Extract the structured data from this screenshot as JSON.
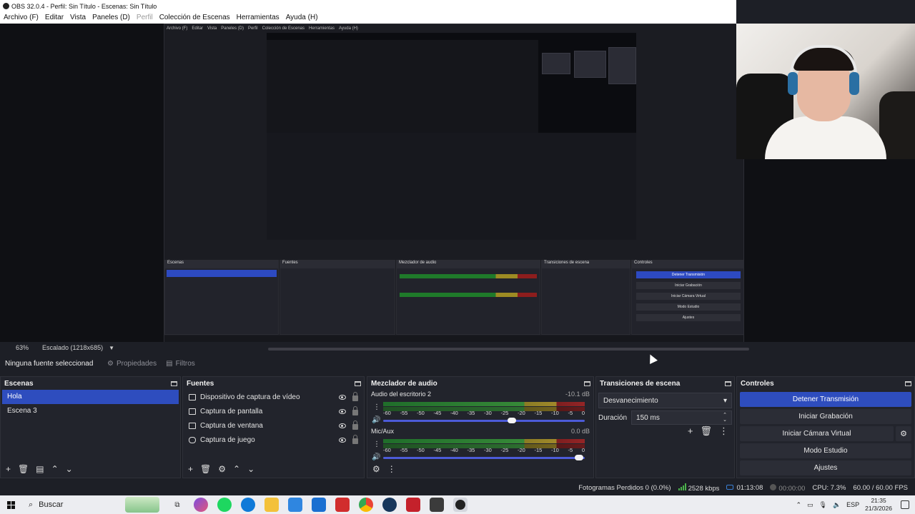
{
  "window": {
    "title": "OBS 32.0.4 - Perfil: Sin Título - Escenas: Sin Título"
  },
  "menu": {
    "items": [
      "Archivo (F)",
      "Editar",
      "Vista",
      "Paneles (D)",
      "Perfil",
      "Colección de Escenas",
      "Herramientas",
      "Ayuda (H)"
    ]
  },
  "preview": {
    "zoom": "63%",
    "scale_label": "Escalado (1218x685)",
    "nested": {
      "menu": [
        "Archivo (F)",
        "Editar",
        "Vista",
        "Paneles (D)",
        "Perfil",
        "Colección de Escenas",
        "Herramientas",
        "Ayuda (H)"
      ],
      "docks": [
        "Escenas",
        "Fuentes",
        "Mezclador de audio",
        "Transiciones de escena",
        "Controles"
      ],
      "buttons": [
        "Detener Transmisión",
        "Iniciar Grabación",
        "Iniciar Cámara Virtual",
        "Modo Estudio",
        "Ajustes"
      ]
    }
  },
  "context_bar": {
    "no_source": "Ninguna fuente seleccionad",
    "properties": "Propiedades",
    "filters": "Filtros"
  },
  "scenes": {
    "title": "Escenas",
    "items": [
      {
        "label": "Hola",
        "selected": true
      },
      {
        "label": "Escena 3",
        "selected": false
      }
    ]
  },
  "sources": {
    "title": "Fuentes",
    "items": [
      {
        "label": "Dispositivo de captura de vídeo",
        "icon": "camera-icon"
      },
      {
        "label": "Captura de pantalla",
        "icon": "monitor-icon"
      },
      {
        "label": "Captura de ventana",
        "icon": "window-icon"
      },
      {
        "label": "Captura de juego",
        "icon": "gamepad-icon"
      }
    ]
  },
  "mixer": {
    "title": "Mezclador de audio",
    "channels": [
      {
        "name": "Audio del escritorio 2",
        "db": "-10.1 dB",
        "fader": 0.64
      },
      {
        "name": "Mic/Aux",
        "db": "0.0 dB",
        "fader": 0.97
      }
    ],
    "ticks": [
      "-60",
      "-55",
      "-50",
      "-45",
      "-40",
      "-35",
      "-30",
      "-25",
      "-20",
      "-15",
      "-10",
      "-5",
      "0"
    ]
  },
  "transitions": {
    "title": "Transiciones de escena",
    "selected": "Desvanecimiento",
    "duration_label": "Duración",
    "duration_value": "150 ms"
  },
  "controls": {
    "title": "Controles",
    "stop_stream": "Detener Transmisión",
    "start_recording": "Iniciar Grabación",
    "start_virtualcam": "Iniciar Cámara Virtual",
    "studio_mode": "Modo Estudio",
    "settings": "Ajustes"
  },
  "status": {
    "dropped_frames": "Fotogramas Perdidos 0 (0.0%)",
    "bitrate": "2528 kbps",
    "stream_time": "01:13:08",
    "rec_time": "00:00:00",
    "cpu": "CPU: 7.3%",
    "fps": "60.00 / 60.00 FPS"
  },
  "taskbar": {
    "search_placeholder": "Buscar",
    "language": "ESP",
    "time": "21:35",
    "date": "21/3/2026"
  },
  "colors": {
    "accent": "#2e4dbe",
    "dock_bg": "#22242c",
    "bg": "#1d1f26"
  }
}
